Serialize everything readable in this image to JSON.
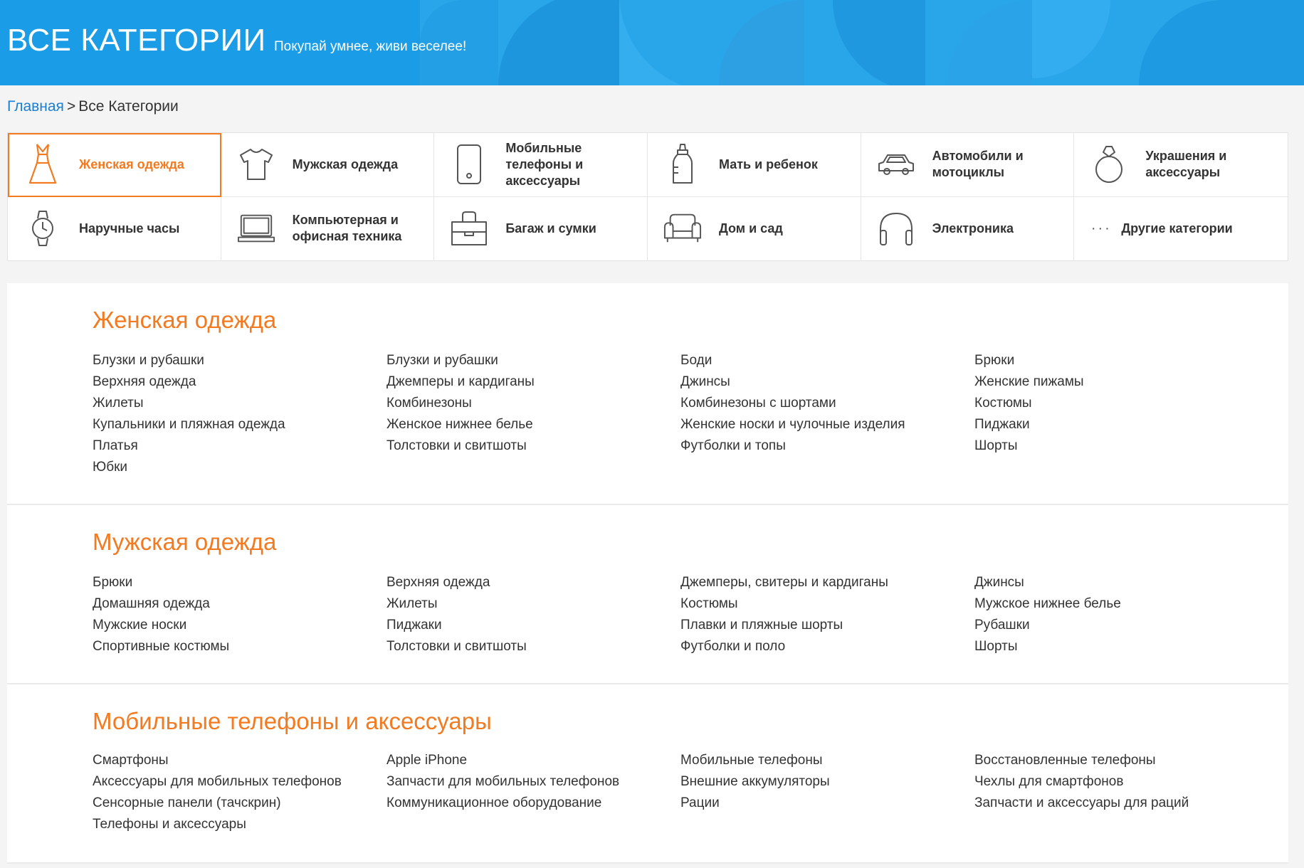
{
  "header": {
    "title": "ВСЕ КАТЕГОРИИ",
    "slogan": "Покупай умнее, живи веселее!",
    "bg_color": "#1a9de6"
  },
  "breadcrumb": {
    "home": "Главная",
    "separator": ">",
    "current": "Все Категории"
  },
  "category_tiles": [
    {
      "label": "Женская одежда",
      "icon": "dress-icon",
      "active": true
    },
    {
      "label": "Мужская одежда",
      "icon": "tshirt-icon"
    },
    {
      "label": "Мобильные телефоны и аксессуары",
      "icon": "phone-icon"
    },
    {
      "label": "Мать и ребенок",
      "icon": "baby-bottle-icon"
    },
    {
      "label": "Автомобили и мотоциклы",
      "icon": "car-icon"
    },
    {
      "label": "Украшения и аксессуары",
      "icon": "ring-icon"
    },
    {
      "label": "Наручные часы",
      "icon": "watch-icon"
    },
    {
      "label": "Компьютерная и офисная техника",
      "icon": "laptop-icon"
    },
    {
      "label": "Багаж и сумки",
      "icon": "bag-icon"
    },
    {
      "label": "Дом и сад",
      "icon": "sofa-icon"
    },
    {
      "label": "Электроника",
      "icon": "headphones-icon"
    },
    {
      "label": "Другие категории",
      "icon": "more-dots-icon"
    }
  ],
  "accent_color": "#f27a21",
  "sections": [
    {
      "title": "Женская одежда",
      "columns": [
        [
          "Блузки и рубашки",
          "Верхняя одежда",
          "Жилеты",
          "Купальники и пляжная одежда",
          "Платья",
          "Юбки"
        ],
        [
          "Блузки и рубашки",
          "Джемперы и кардиганы",
          "Комбинезоны",
          "Женское нижнее белье",
          "Толстовки и свитшоты"
        ],
        [
          "Боди",
          "Джинсы",
          "Комбинезоны с шортами",
          "Женские носки и чулочные изделия",
          "Футболки и топы"
        ],
        [
          "Брюки",
          "Женские пижамы",
          "Костюмы",
          "Пиджаки",
          "Шорты"
        ]
      ]
    },
    {
      "title": "Мужская одежда",
      "columns": [
        [
          "Брюки",
          "Домашняя одежда",
          "Мужские носки",
          "Спортивные костюмы"
        ],
        [
          "Верхняя одежда",
          "Жилеты",
          "Пиджаки",
          "Толстовки и свитшоты"
        ],
        [
          "Джемперы, свитеры и кардиганы",
          "Костюмы",
          "Плавки и пляжные шорты",
          "Футболки и поло"
        ],
        [
          "Джинсы",
          "Мужское нижнее белье",
          "Рубашки",
          "Шорты"
        ]
      ]
    },
    {
      "title": "Мобильные телефоны и аксессуары",
      "columns": [
        [
          "Смартфоны",
          "Аксессуары для мобильных телефонов",
          "Сенсорные панели (тачскрин)",
          "Телефоны и аксессуары"
        ],
        [
          "Apple iPhone",
          "Запчасти для мобильных телефонов",
          "Коммуникационное оборудование"
        ],
        [
          "Мобильные телефоны",
          "Внешние аккумуляторы",
          "Рации"
        ],
        [
          "Восстановленные телефоны",
          "Чехлы для смартфонов",
          "Запчасти и аксессуары для раций"
        ]
      ]
    }
  ]
}
